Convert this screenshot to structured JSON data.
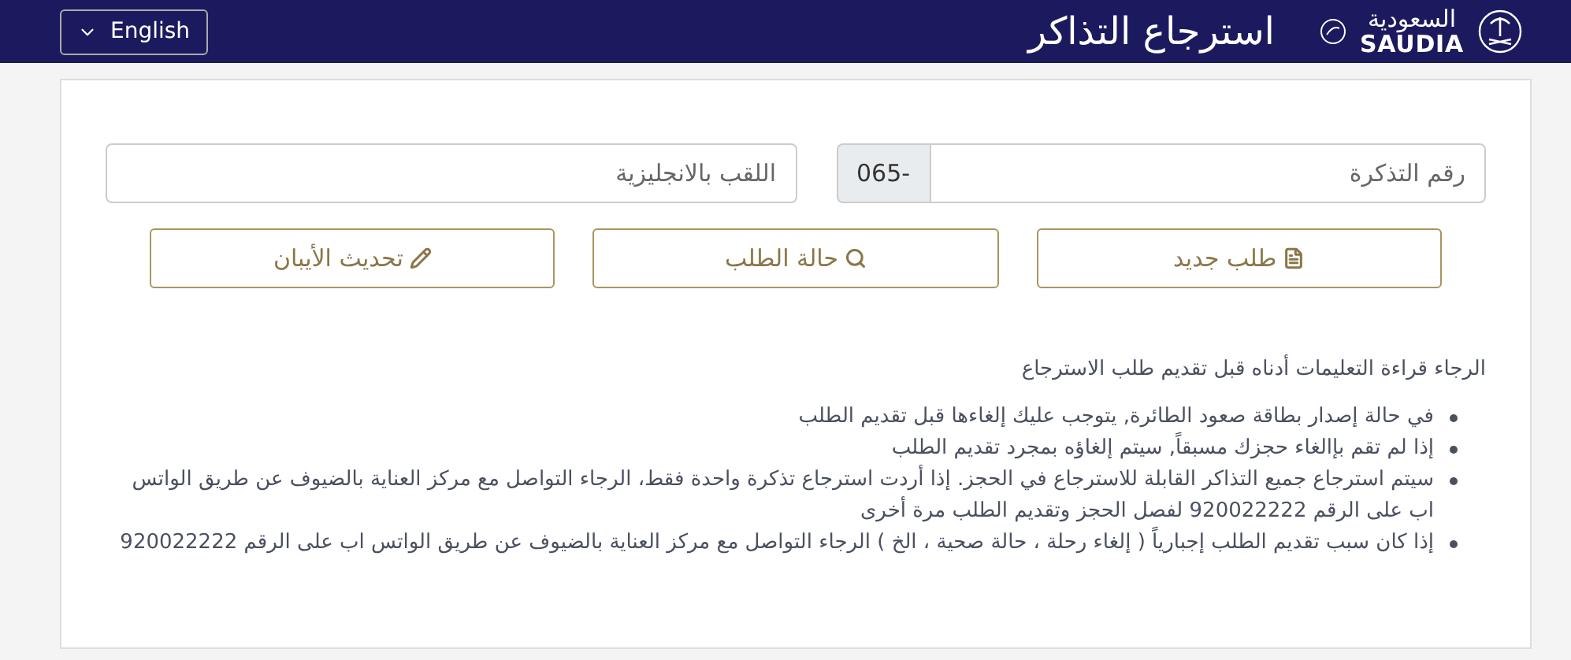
{
  "header": {
    "logo_arabic": "السعودية",
    "logo_latin": "SAUDIA",
    "title": "استرجاع التذاكر",
    "language_button": "English"
  },
  "form": {
    "ticket_field": {
      "placeholder": "رقم التذكرة",
      "prefix": "065-"
    },
    "surname_field": {
      "placeholder": "اللقب بالانجليزية"
    }
  },
  "buttons": [
    {
      "kind": "new",
      "label": "طلب جديد"
    },
    {
      "kind": "status",
      "label": "حالة الطلب"
    },
    {
      "kind": "update",
      "label": "تحديث الأيبان"
    }
  ],
  "instructions": {
    "intro": "الرجاء قراءة التعليمات أدناه قبل تقديم طلب الاسترجاع",
    "items": [
      "في حالة إصدار بطاقة صعود الطائرة, يتوجب عليك إلغاءها قبل تقديم الطلب",
      "إذا لم تقم بإالغاء حجزك مسبقاً, سيتم إلغاؤه بمجرد تقديم الطلب",
      "سيتم استرجاع جميع التذاكر القابلة للاسترجاع في الحجز. إذا أردت استرجاع تذكرة واحدة فقط، الرجاء التواصل مع مركز العناية بالضيوف عن طريق الواتس اب على الرقم 920022222 لفصل الحجز وتقديم الطلب مرة أخرى",
      "إذا كان سبب تقديم الطلب إجبارياً ( إلغاء رحلة ، حالة صحية ، الخ ) الرجاء التواصل مع مركز العناية بالضيوف عن طريق الواتس اب على الرقم 920022222"
    ]
  }
}
